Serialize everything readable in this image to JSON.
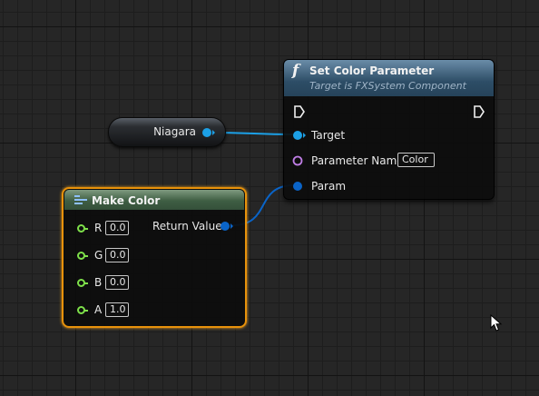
{
  "colors": {
    "object_pin": "#1ca0e6",
    "struct_pin": "#0a64c8",
    "name_pin": "#c07ee6",
    "float_pin": "#7ee04a",
    "selected_outline": "#e8920b"
  },
  "niagara_node": {
    "label": "Niagara",
    "pin_icon": "object-pin-icon"
  },
  "set_color_node": {
    "icon": "function-icon",
    "title": "Set Color Parameter",
    "subtitle": "Target is FXSystem Component",
    "pins": {
      "target_label": "Target",
      "parameter_name_label": "Parameter Name",
      "parameter_name_value": "Color",
      "param_label": "Param"
    }
  },
  "make_color_node": {
    "icon": "make-struct-icon",
    "title": "Make Color",
    "inputs": [
      {
        "label": "R",
        "value": "0.0"
      },
      {
        "label": "G",
        "value": "0.0"
      },
      {
        "label": "B",
        "value": "0.0"
      },
      {
        "label": "A",
        "value": "1.0"
      }
    ],
    "output_label": "Return Value"
  }
}
